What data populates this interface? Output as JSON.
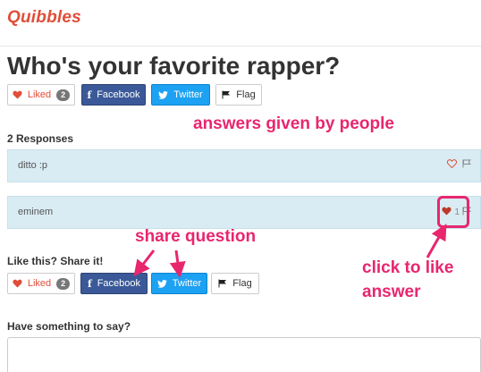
{
  "app": {
    "brand": "Quibbles"
  },
  "question": {
    "title": "Who's your favorite rapper?"
  },
  "actions": {
    "liked_label": "Liked",
    "liked_count": "2",
    "facebook_label": "Facebook",
    "twitter_label": "Twitter",
    "flag_label": "Flag"
  },
  "responses": {
    "heading": "2 Responses",
    "items": [
      {
        "text": "ditto :p",
        "likes": ""
      },
      {
        "text": "eminem",
        "likes": "1"
      }
    ]
  },
  "share": {
    "heading": "Like this? Share it!",
    "liked_label": "Liked",
    "liked_count": "2",
    "facebook_label": "Facebook",
    "twitter_label": "Twitter",
    "flag_label": "Flag"
  },
  "comment": {
    "heading": "Have something to say?"
  },
  "annotations": {
    "answers": "answers given by people",
    "share": "share question",
    "like_line1": "click to like",
    "like_line2": "answer"
  },
  "colors": {
    "brand": "#e04e39",
    "facebook": "#3b5998",
    "twitter": "#1da1f2",
    "annotation": "#e8266e",
    "answer_bg": "#d9ecf4"
  }
}
